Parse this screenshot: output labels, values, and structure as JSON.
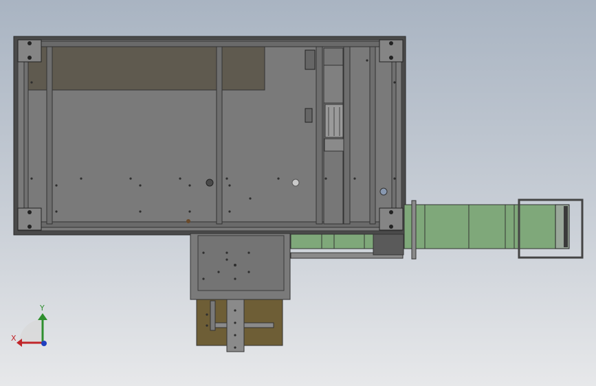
{
  "viewport": {
    "background_top": "#a9b4c2",
    "background_bottom": "#e7e8ea"
  },
  "model": {
    "frame_color": "#6b6b6b",
    "frame_edge_color": "#3a3a3a",
    "panel_color": "#7a7a7a",
    "plate_color": "#5f5a4f",
    "conveyor_color": "#7fa87a",
    "base_plate_color": "#6e5e36"
  },
  "triad": {
    "x_label": "X",
    "y_label": "Y",
    "x_color": "#c0252a",
    "y_color": "#2f8f2f",
    "z_color": "#1f3fbf"
  }
}
